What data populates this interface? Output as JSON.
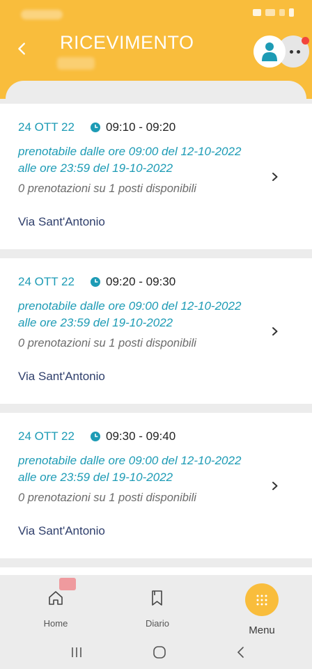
{
  "header": {
    "title": "RICEVIMENTO",
    "background_color": "#f9bd3c",
    "notification_color": "#f2453d"
  },
  "slots": [
    {
      "date": "24 OTT 22",
      "time": "09:10 - 09:20",
      "booking_line1": "prenotabile dalle ore 09:00 del 12-10-2022",
      "booking_line2": "alle ore 23:59 del 19-10-2022",
      "availability": "0 prenotazioni su 1 posti disponibili",
      "location": "Via Sant'Antonio"
    },
    {
      "date": "24 OTT 22",
      "time": "09:20 - 09:30",
      "booking_line1": "prenotabile dalle ore 09:00 del 12-10-2022",
      "booking_line2": "alle ore 23:59 del 19-10-2022",
      "availability": "0 prenotazioni su 1 posti disponibili",
      "location": "Via Sant'Antonio"
    },
    {
      "date": "24 OTT 22",
      "time": "09:30 - 09:40",
      "booking_line1": "prenotabile dalle ore 09:00 del 12-10-2022",
      "booking_line2": "alle ore 23:59 del 19-10-2022",
      "availability": "0 prenotazioni su 1 posti disponibili",
      "location": "Via Sant'Antonio"
    }
  ],
  "bottom_nav": {
    "home_label": "Home",
    "diario_label": "Diario",
    "menu_label": "Menu"
  },
  "colors": {
    "accent_teal": "#1d9bb5",
    "location_text": "#2e3e6b"
  }
}
